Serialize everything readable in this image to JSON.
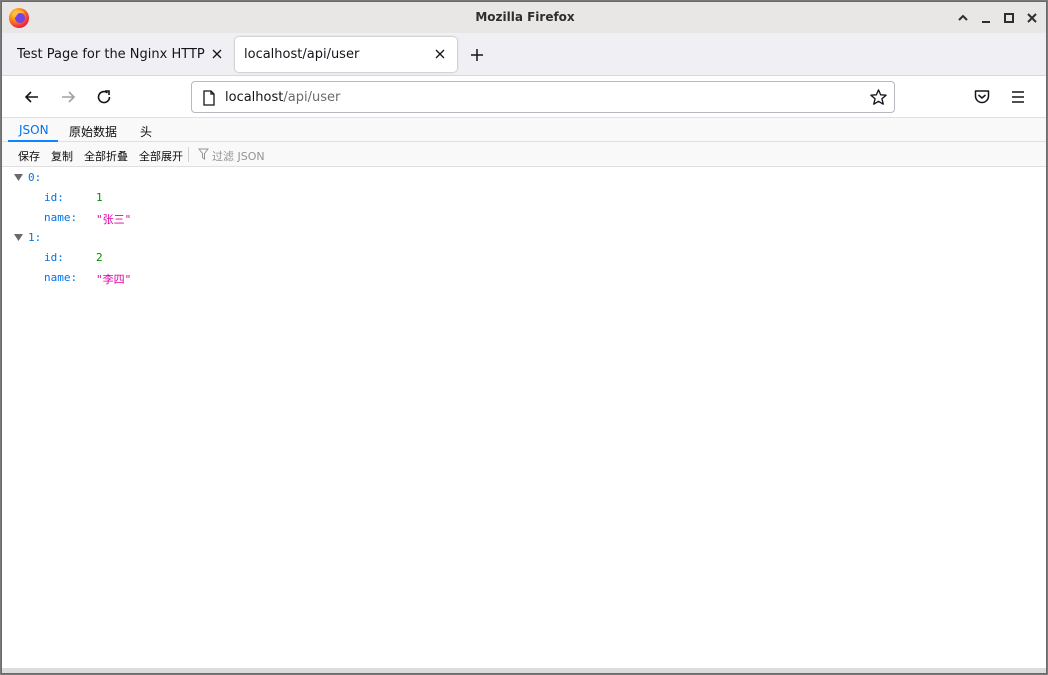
{
  "window": {
    "title": "Mozilla Firefox"
  },
  "tabs": [
    {
      "label": "Test Page for the Nginx HTTP Se",
      "active": false
    },
    {
      "label": "localhost/api/user",
      "active": true
    }
  ],
  "navbar": {
    "url_host": "localhost",
    "url_path": "/api/user"
  },
  "json_viewer": {
    "tabs": [
      "JSON",
      "原始数据",
      "头"
    ],
    "toolbar": {
      "save": "保存",
      "copy": "复制",
      "collapse_all": "全部折叠",
      "expand_all": "全部展开",
      "filter_placeholder": "过滤 JSON"
    },
    "tree": [
      {
        "key": "0:",
        "children": [
          {
            "key": "id:",
            "value": "1",
            "type": "number"
          },
          {
            "key": "name:",
            "value": "\"张三\"",
            "type": "string"
          }
        ]
      },
      {
        "key": "1:",
        "children": [
          {
            "key": "id:",
            "value": "2",
            "type": "number"
          },
          {
            "key": "name:",
            "value": "\"李四\"",
            "type": "string"
          }
        ]
      }
    ]
  },
  "colors": {
    "accent": "#0a84ff",
    "key": "#0074e8",
    "number": "#058b00",
    "string": "#dd00a9"
  },
  "icons": [
    "firefox-logo",
    "minimize-up-icon",
    "minimize-icon",
    "maximize-icon",
    "close-icon",
    "tab-close-icon",
    "new-tab-icon",
    "back-icon",
    "forward-icon",
    "reload-icon",
    "page-icon",
    "bookmark-star-icon",
    "pocket-icon",
    "menu-icon",
    "filter-icon",
    "twisty-icon"
  ]
}
